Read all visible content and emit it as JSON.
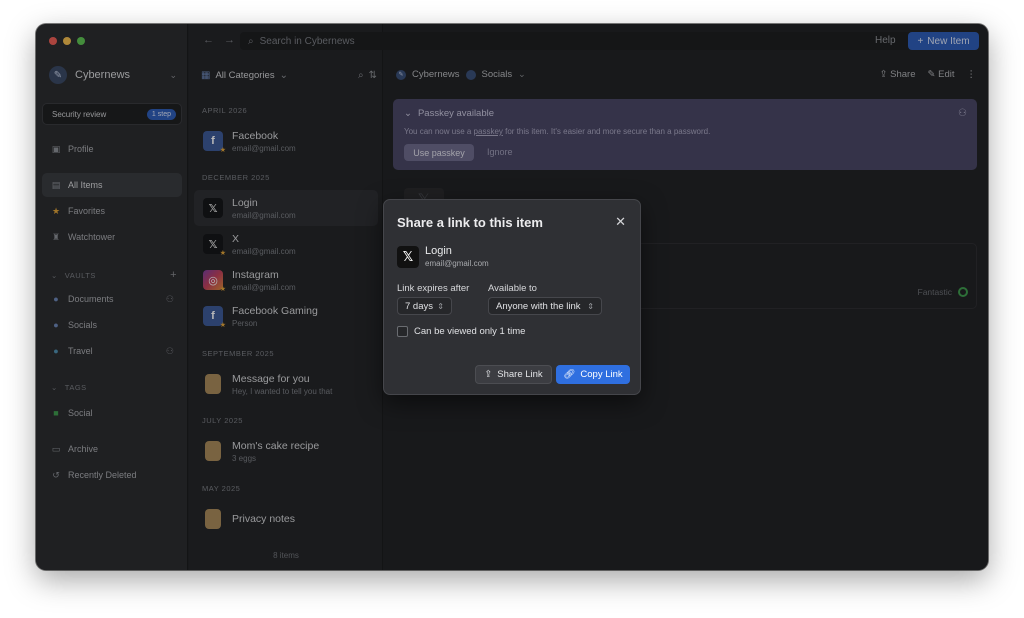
{
  "colors": {
    "close": "#ee5f57",
    "minimize": "#f3bd4f",
    "maximize": "#5fc454",
    "accent": "#2f6fe0",
    "passkey_bg": "#4a4766"
  },
  "sidebar": {
    "account": "Cybernews",
    "security_review": {
      "label": "Security review",
      "badge": "1 step"
    },
    "profile": "Profile",
    "items": [
      {
        "label": "All Items",
        "icon": "list-icon"
      },
      {
        "label": "Favorites",
        "icon": "star-icon"
      },
      {
        "label": "Watchtower",
        "icon": "tower-icon"
      }
    ],
    "vaults_header": "VAULTS",
    "vaults": [
      {
        "label": "Documents"
      },
      {
        "label": "Socials"
      },
      {
        "label": "Travel"
      }
    ],
    "tags_header": "TAGS",
    "tags": [
      {
        "label": "Social"
      }
    ],
    "archive": "Archive",
    "recently_deleted": "Recently Deleted"
  },
  "list": {
    "category": "All Categories",
    "groups": [
      {
        "header": "APRIL 2026",
        "items": [
          {
            "title": "Facebook",
            "sub": "email@gmail.com"
          }
        ]
      },
      {
        "header": "DECEMBER 2025",
        "items": [
          {
            "title": "Login",
            "sub": "email@gmail.com"
          },
          {
            "title": "X",
            "sub": "email@gmail.com"
          },
          {
            "title": "Instagram",
            "sub": "email@gmail.com"
          },
          {
            "title": "Facebook Gaming",
            "sub": "Person"
          }
        ]
      },
      {
        "header": "SEPTEMBER 2025",
        "items": [
          {
            "title": "Message for you",
            "sub": "Hey, I wanted to tell you that"
          }
        ]
      },
      {
        "header": "JULY 2025",
        "items": [
          {
            "title": "Mom's cake recipe",
            "sub": "3 eggs"
          }
        ]
      },
      {
        "header": "MAY 2025",
        "items": [
          {
            "title": "Privacy notes",
            "sub": ""
          }
        ]
      }
    ],
    "count": "8 items"
  },
  "toolbar": {
    "search_placeholder": "Search in Cybernews",
    "help": "Help",
    "new_item": "New Item"
  },
  "detail": {
    "breadcrumb": {
      "account": "Cybernews",
      "vault": "Socials"
    },
    "share": "Share",
    "edit": "Edit",
    "passkey": {
      "title": "Passkey available",
      "text_before": "You can now use a ",
      "text_link": "passkey",
      "text_after": " for this item. It's easier and more secure than a password.",
      "use": "Use passkey",
      "ignore": "Ignore"
    },
    "strength": "Fantastic"
  },
  "modal": {
    "title": "Share a link to this item",
    "item_title": "Login",
    "item_sub": "email@gmail.com",
    "expires_label": "Link expires after",
    "expires_value": "7 days",
    "available_label": "Available to",
    "available_value": "Anyone with the link",
    "checkbox_label": "Can be viewed only 1 time",
    "share_link": "Share Link",
    "copy_link": "Copy Link"
  }
}
